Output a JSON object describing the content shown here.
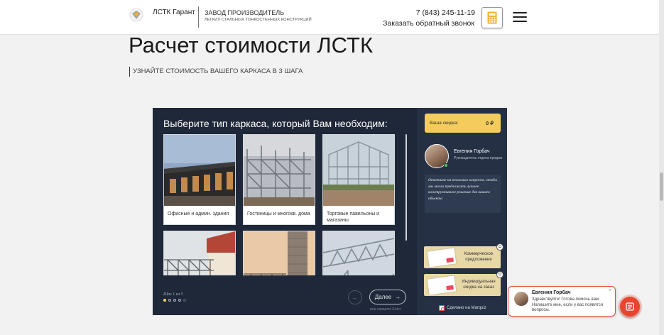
{
  "header": {
    "brand": "ЛСТК Гарант",
    "tagline_main": "ЗАВОД ПРОИЗВОДИТЕЛЬ",
    "tagline_sub": "ЛЕГКИХ СТАЛЬНЫХ ТОНКОСТЕННЫХ КОНСТРУКЦИЙ",
    "phone": "7 (843) 245-11-19",
    "callback": "Заказать обратный звонок",
    "icons": [
      "logo-icon",
      "calculator-icon",
      "menu-icon"
    ]
  },
  "page": {
    "title": "Расчет стоимости ЛСТК",
    "subtitle": "УЗНАЙТЕ СТОИМОСТЬ ВАШЕГО КАРКАСА В 3 ШАГА"
  },
  "quiz": {
    "question": "Выберите тип каркаса, который Вам необходим:",
    "options": [
      {
        "label": "Офисные и админ. здания"
      },
      {
        "label": "Гостиницы и многокв. дома"
      },
      {
        "label": "Торговые павильоны и магазины"
      },
      {
        "label": ""
      },
      {
        "label": ""
      },
      {
        "label": ""
      }
    ],
    "step_text": "Шаг 1 из 5",
    "steps_total": 5,
    "step_current": 1,
    "next_label": "Далее",
    "enter_hint": "или нажмите Enter",
    "sidebar": {
      "discount_label": "Ваша скидка:",
      "discount_value": "0 ₽",
      "manager_name": "Евгения Горбач",
      "manager_role": "Руководитель отдела продаж",
      "message": "Ответьте на несколько вопросов, чтобы мы могли предложить лучшее конструктивное решение для вашего объекта",
      "bonus1": "Коммерческое предложение",
      "bonus2": "Индивидуальная скидка на заказ",
      "made_with": "Сделано на Marquiz"
    }
  },
  "chat": {
    "name": "Евгения Горбач",
    "text": "Здравствуйте! Готова помочь вам. Напишите мне, если у вас появятся вопросы.",
    "close": "×"
  },
  "colors": {
    "quiz_bg": "#1e2838",
    "quiz_sidebar": "#253044",
    "discount": "#f4cc5e",
    "accent": "#e8452f"
  }
}
